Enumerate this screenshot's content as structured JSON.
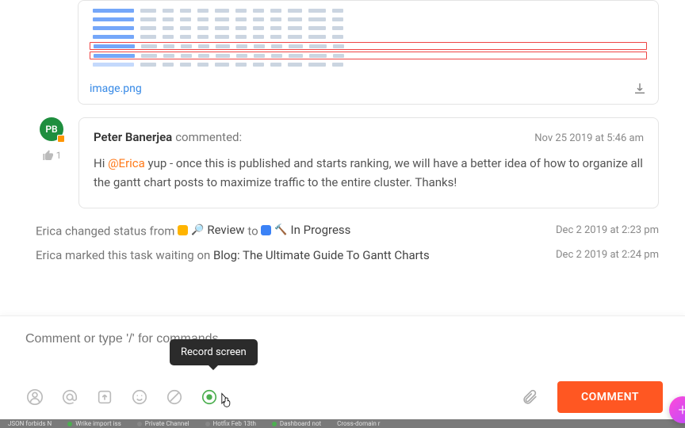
{
  "attachment": {
    "filename": "image.png"
  },
  "comment": {
    "avatar_initials": "PB",
    "author": "Peter Banerjea",
    "commented_label": "commented:",
    "timestamp": "Nov 25 2019 at 5:46 am",
    "body_prefix": "Hi ",
    "mention": "@Erica",
    "body_rest": " yup - once this is published and starts ranking, we will have a better idea of how to organize all the gantt chart posts to maximize traffic to the entire cluster. Thanks!",
    "like_count": "1"
  },
  "activity1": {
    "prefix": "Erica changed status from ",
    "from_status": "Review",
    "to_label": " to ",
    "to_status": "In Progress",
    "timestamp": "Dec 2 2019 at 2:23 pm"
  },
  "activity2": {
    "prefix": "Erica marked this task waiting on ",
    "task": "Blog: The Ultimate Guide To Gantt Charts",
    "timestamp": "Dec 2 2019 at 2:24 pm"
  },
  "compose": {
    "placeholder": "Comment or type '/' for commands",
    "tooltip": "Record screen",
    "button": "COMMENT"
  },
  "bottombar": {
    "items": [
      "JSON forbids N",
      "Wrike import iss",
      "Private Channel",
      "Hotfix Feb 13th",
      "Dashboard not",
      "Cross-domain r"
    ]
  }
}
